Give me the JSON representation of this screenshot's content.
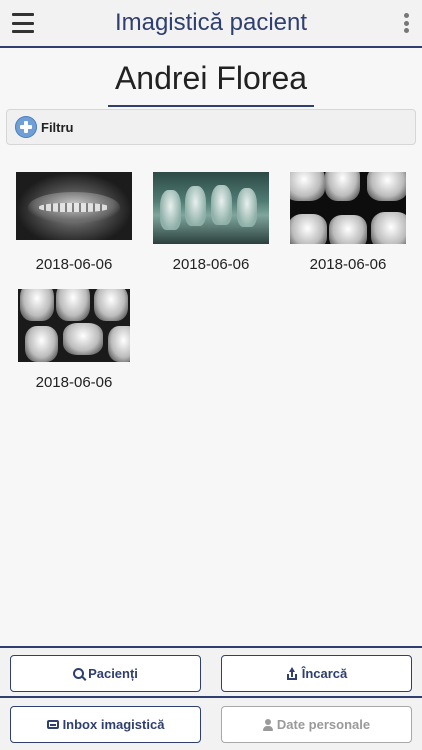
{
  "header": {
    "title": "Imagistică pacient",
    "menu_icon": "hamburger-menu-icon",
    "more_icon": "more-vertical-icon"
  },
  "patient": {
    "name": "Andrei Florea"
  },
  "filter": {
    "label": "Filtru",
    "icon": "plus-circle-icon"
  },
  "images": [
    {
      "date": "2018-06-06",
      "kind": "panoramic"
    },
    {
      "date": "2018-06-06",
      "kind": "bitewing-green"
    },
    {
      "date": "2018-06-06",
      "kind": "bitewing"
    },
    {
      "date": "2018-06-06",
      "kind": "bitewing"
    }
  ],
  "footer": {
    "patients_label": "Pacienți",
    "upload_label": "Încarcă",
    "inbox_label": "Inbox imagistică",
    "personal_label": "Date personale"
  },
  "colors": {
    "accent": "#2f4070",
    "background": "#f7f7f7",
    "disabled": "#9a9a9a"
  }
}
